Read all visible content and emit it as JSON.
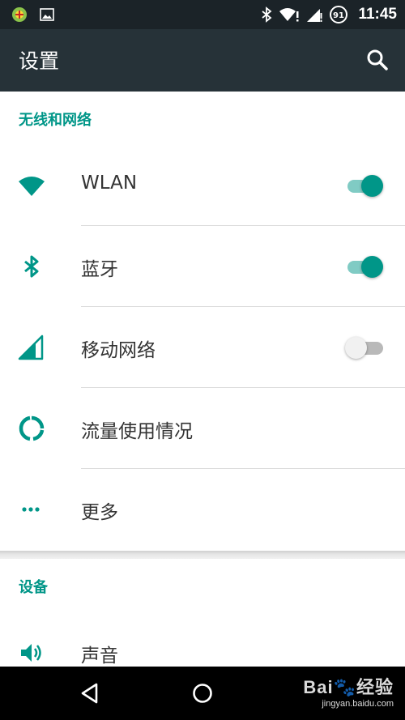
{
  "status_bar": {
    "time": "11:45",
    "battery_level": "91"
  },
  "app_bar": {
    "title": "设置"
  },
  "sections": {
    "wireless": {
      "header": "无线和网络",
      "items": [
        {
          "label": "WLAN",
          "icon": "wifi-icon",
          "toggle": "on"
        },
        {
          "label": "蓝牙",
          "icon": "bluetooth-icon",
          "toggle": "on"
        },
        {
          "label": "移动网络",
          "icon": "cellular-signal-icon",
          "toggle": "off"
        },
        {
          "label": "流量使用情况",
          "icon": "data-usage-icon"
        },
        {
          "label": "更多",
          "icon": "more-dots-icon"
        }
      ]
    },
    "device": {
      "header": "设备",
      "items": [
        {
          "label": "声音",
          "icon": "volume-icon"
        }
      ]
    }
  },
  "nav_bar": {
    "watermark_logo": "Bai🐾经验",
    "watermark_url": "jingyan.baidu.com"
  },
  "colors": {
    "accent": "#009688",
    "app_bar": "#263238",
    "status_bar": "#1b2328"
  }
}
